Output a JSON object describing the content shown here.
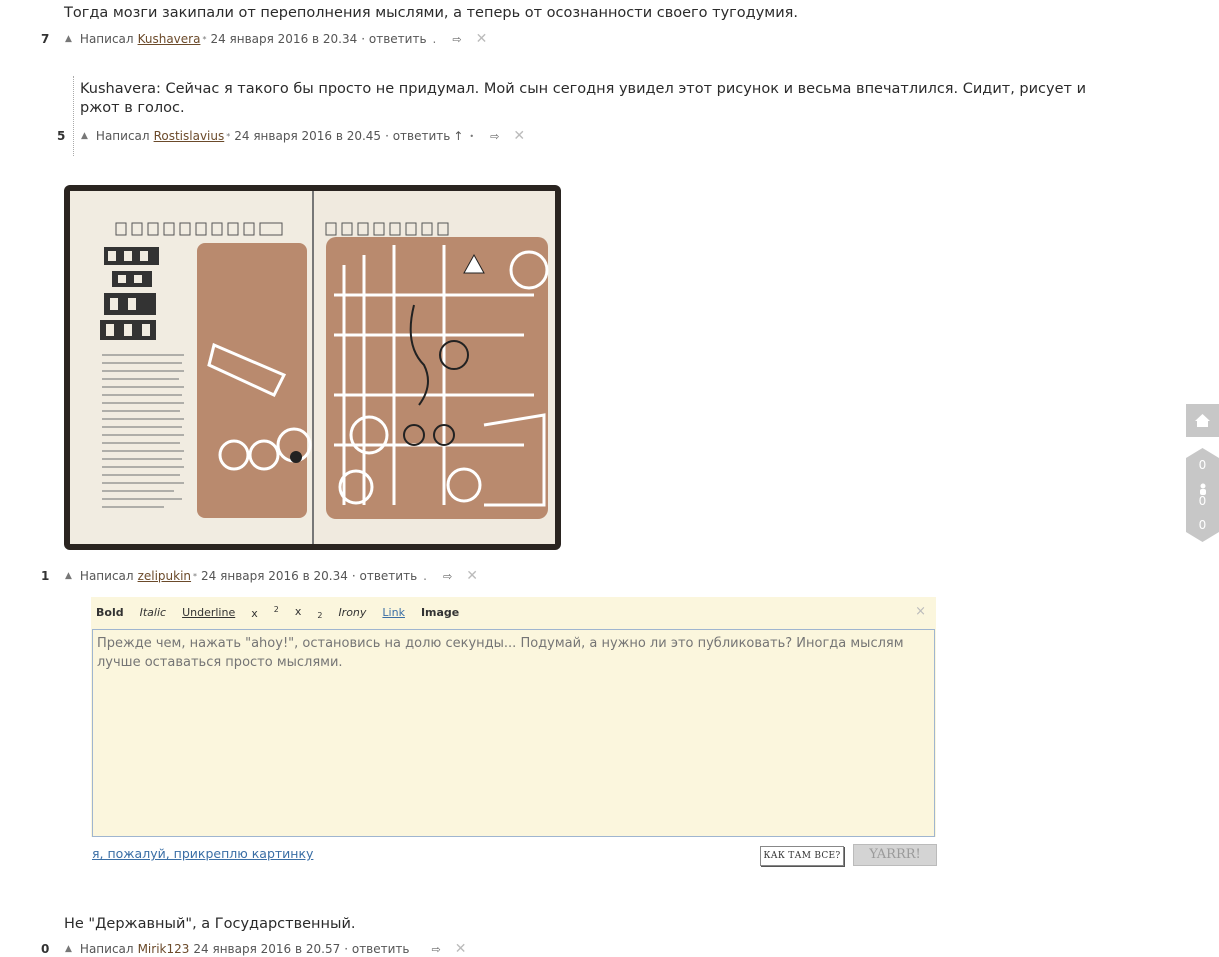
{
  "comments": [
    {
      "text": "Тогда мозги закипали от переполнения мыслями, а теперь от осознанности своего тугодумия.",
      "rating": "7",
      "written_by": "Написал",
      "author": "Kushavera",
      "date": "24 января 2016 в 20.34",
      "reply": "· ответить",
      "dot": "."
    },
    {
      "text": "Kushavera: Сейчас я такого бы просто не придумал. Мой сын сегодня увидел этот рисунок и весьма впечатлился. Сидит, рисует и ржот в голос.",
      "rating": "5",
      "written_by": "Написал",
      "author": "Rostislavius",
      "date": "24 января 2016 в 20.45",
      "reply": "· ответить",
      "up_arrow": "↑",
      "dot": "•"
    },
    {
      "rating": "1",
      "written_by": "Написал",
      "author": "zelipukin",
      "date": "24 января 2016 в 20.34",
      "reply": "· ответить",
      "dot": "."
    },
    {
      "text": "Не \"Державный\", а Государственный.",
      "rating": "0",
      "written_by": "Написал",
      "author": "Mirik123",
      "date": "24 января 2016 в 20.57",
      "reply": "· ответить"
    }
  ],
  "icons": {
    "vote_up": "▲",
    "share": "⇨",
    "close": "✕",
    "superscript_marker": "*"
  },
  "editor": {
    "toolbar": {
      "bold": "Bold",
      "italic": "Italic",
      "underline": "Underline",
      "superscript": "x",
      "superscript_exp": "2",
      "subscript": "x",
      "subscript_exp": "2",
      "irony": "Irony",
      "link": "Link",
      "image": "Image",
      "close": "×"
    },
    "placeholder": "Прежде чем, нажать \"ahoy!\", остановись на долю секунды... Подумай, а нужно ли это публиковать? Иногда мыслям лучше оставаться просто мыслями.",
    "attach_link": "я, пожалуй, прикреплю картинку",
    "preview_button": "КАК ТАМ ВСЕ?",
    "submit_button": "YARRR!"
  },
  "sidebar": {
    "home_icon": "home-icon",
    "counter_top": "0",
    "counter_middle": "0",
    "counter_bottom": "0"
  },
  "colors": {
    "editor_bg": "#fbf6dd",
    "author_link": "#6b4a2a",
    "link_blue": "#3a6ea5",
    "illustration_brown": "#b98a6e"
  }
}
